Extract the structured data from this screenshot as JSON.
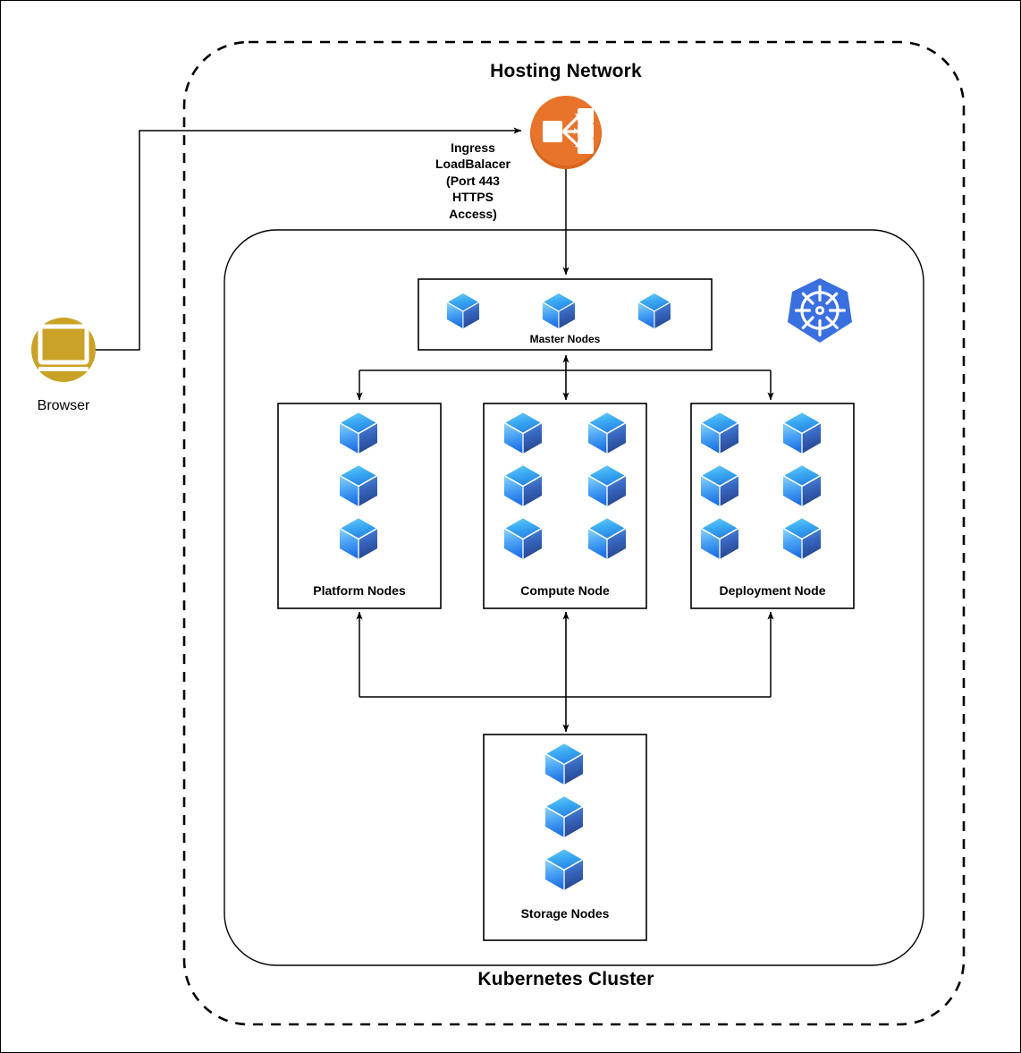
{
  "diagram": {
    "outer_container": {
      "label": "Hosting Network",
      "style": "dashed-rounded"
    },
    "inner_container": {
      "label": "Kubernetes Cluster",
      "style": "solid-rounded"
    },
    "browser": {
      "label": "Browser",
      "icon": "browser-monitor-icon",
      "color": "#C9A227"
    },
    "ingress": {
      "label": "Ingress\nLoadBalacer\n(Port 443\nHTTPS\nAccess)",
      "icon": "load-balancer-icon",
      "color": "#E8742C"
    },
    "kubernetes_logo": {
      "name": "kubernetes-logo-icon",
      "color": "#3A6FE0"
    },
    "node_groups": [
      {
        "id": "master",
        "label": "Master Nodes",
        "cubes": 3,
        "columns": 3,
        "label_position": "bottom-inside"
      },
      {
        "id": "platform",
        "label": "Platform Nodes",
        "cubes": 3,
        "columns": 1,
        "label_position": "bottom-inside"
      },
      {
        "id": "compute",
        "label": "Compute Node",
        "cubes": 6,
        "columns": 2,
        "label_position": "bottom-inside"
      },
      {
        "id": "deployment",
        "label": "Deployment Node",
        "cubes": 6,
        "columns": 2,
        "label_position": "bottom-inside"
      },
      {
        "id": "storage",
        "label": "Storage Nodes",
        "cubes": 3,
        "columns": 1,
        "label_position": "bottom-inside"
      }
    ],
    "cube_colors": {
      "top_light": "#63CBF7",
      "top_dark": "#2C8BE8",
      "left_light": "#64BEF8",
      "left_dark": "#1F74E8",
      "right_light": "#3C7BD6",
      "right_dark": "#2B4C9B"
    },
    "connections": [
      {
        "from": "browser",
        "to": "ingress",
        "direction": "one-way"
      },
      {
        "from": "ingress",
        "to": "master",
        "direction": "one-way"
      },
      {
        "from": "master",
        "to": "platform",
        "direction": "one-way"
      },
      {
        "from": "master",
        "to": "compute",
        "direction": "two-way"
      },
      {
        "from": "master",
        "to": "deployment",
        "direction": "one-way"
      },
      {
        "from": "storage",
        "to": "platform",
        "direction": "one-way"
      },
      {
        "from": "storage",
        "to": "compute",
        "direction": "two-way"
      },
      {
        "from": "storage",
        "to": "deployment",
        "direction": "one-way"
      }
    ]
  }
}
